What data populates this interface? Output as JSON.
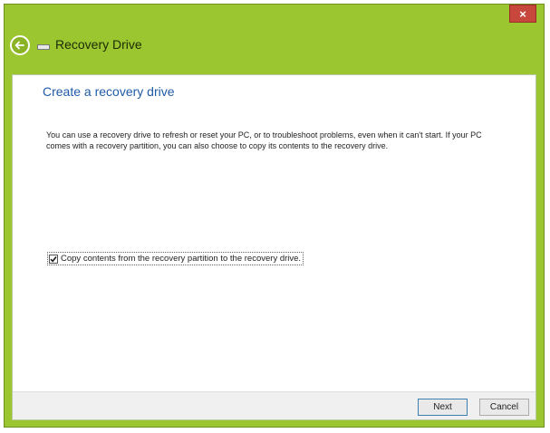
{
  "window": {
    "title": "Recovery Drive",
    "close_symbol": "×",
    "accent_color": "#9bc62f"
  },
  "page": {
    "heading": "Create a recovery drive",
    "description": "You can use a recovery drive to refresh or reset your PC, or to troubleshoot problems, even when it can't start. If your PC comes with a recovery partition, you can also choose to copy its contents to the recovery drive.",
    "checkbox": {
      "label": "Copy contents from the recovery partition to the recovery drive.",
      "checked": true
    }
  },
  "footer": {
    "next_label": "Next",
    "cancel_label": "Cancel"
  },
  "icons": {
    "back": "back-arrow-icon",
    "drive": "drive-icon",
    "close": "close-icon",
    "check": "checkmark-icon"
  }
}
